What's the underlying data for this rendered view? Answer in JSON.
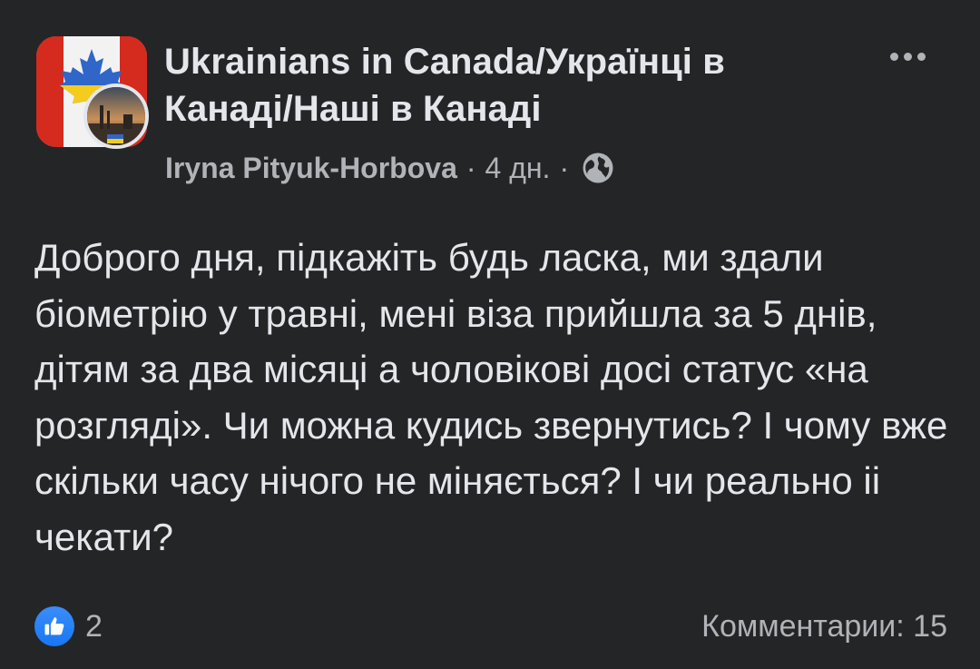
{
  "post": {
    "group_name": "Ukrainians in Canada/Українці в Канаді/Наші в Канаді",
    "author": "Iryna Pityuk-Horbova",
    "separator": "·",
    "time": "4 дн.",
    "privacy_icon": "globe-icon",
    "more_icon": "more-options-icon",
    "text": "Доброго дня, підкажіть будь ласка, ми здали біометрію у травні, мені віза прийшла за 5 днів, дітям за два місяці а чоловікові досі статус «на розгляді». Чи можна кудись звернутись? І чому вже скільки часу нічого не міняється? І чи реально іі чекати?"
  },
  "footer": {
    "reaction_icon": "like-icon",
    "reaction_count": "2",
    "comments_label": "Комментарии: 15"
  },
  "colors": {
    "background": "#242526",
    "primary_text": "#e4e6eb",
    "secondary_text": "#b0b3b8",
    "like_blue": "#1877f2",
    "flag_red": "#d52b1e"
  }
}
